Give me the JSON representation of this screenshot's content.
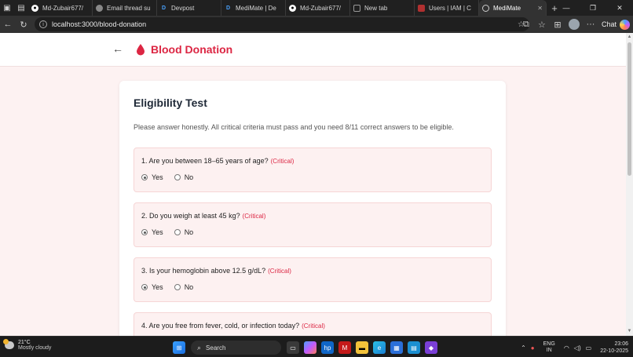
{
  "tabs": [
    {
      "label": "Md-Zubair677/",
      "icon": "github-icon",
      "active": false
    },
    {
      "label": "Email thread su",
      "icon": "circle-icon",
      "active": false
    },
    {
      "label": "Devpost",
      "icon": "devpost-icon",
      "active": false
    },
    {
      "label": "MediMate | De",
      "icon": "devpost-icon",
      "active": false
    },
    {
      "label": "Md-Zubair677/",
      "icon": "github-icon",
      "active": false
    },
    {
      "label": "New tab",
      "icon": "newtab-icon",
      "active": false
    },
    {
      "label": "Users | IAM | C",
      "icon": "aws-icon",
      "active": false
    },
    {
      "label": "MediMate",
      "icon": "globe-icon",
      "active": true
    }
  ],
  "address": {
    "url": "localhost:3000/blood-donation"
  },
  "toolbar": {
    "chat_label": "Chat"
  },
  "header": {
    "title": "Blood Donation"
  },
  "eligibility": {
    "title": "Eligibility Test",
    "intro": "Please answer honestly. All critical criteria must pass and you need 8/11 correct answers to be eligible.",
    "critical_label": "(Critical)",
    "yes_label": "Yes",
    "no_label": "No",
    "questions": [
      {
        "text": "1. Are you between 18–65 years of age?",
        "selected": "Yes"
      },
      {
        "text": "2. Do you weigh at least 45 kg?",
        "selected": "Yes"
      },
      {
        "text": "3. Is your hemoglobin above 12.5 g/dL?",
        "selected": "Yes"
      },
      {
        "text": "4. Are you free from fever, cold, or infection today?",
        "selected": ""
      }
    ]
  },
  "taskbar": {
    "weather_temp": "21°C",
    "weather_text": "Mostly cloudy",
    "search_label": "Search",
    "lang_top": "ENG",
    "lang_bottom": "IN",
    "time": "23:06",
    "date": "22-10-2025"
  },
  "colors": {
    "accent": "#dc2643",
    "question_bg": "#fdf1f1",
    "page_bg": "#fdf2f2"
  }
}
